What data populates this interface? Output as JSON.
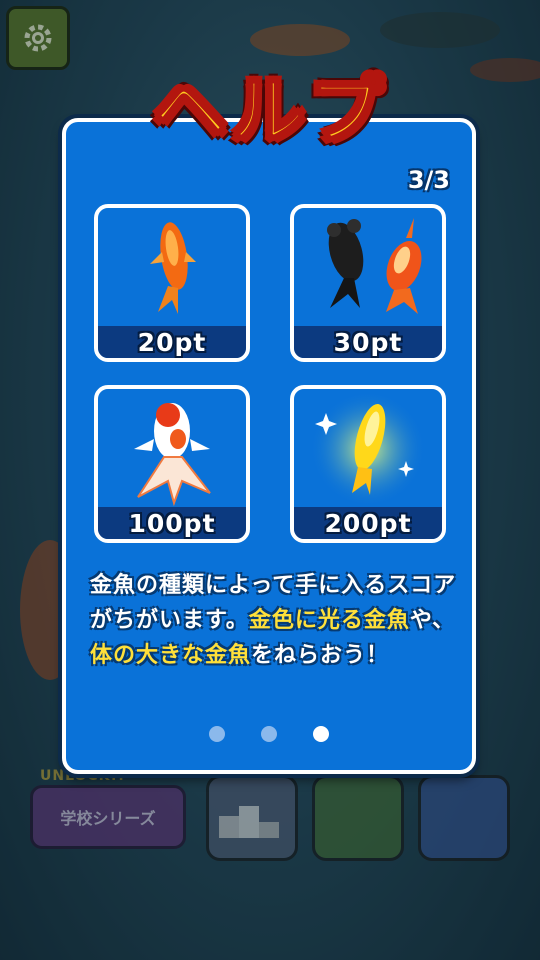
{
  "title": "ヘルプ",
  "page_indicator": "3/3",
  "cards": [
    {
      "points": "20pt",
      "fish": "red-goldfish"
    },
    {
      "points": "30pt",
      "fish": "black-and-red-goldfish"
    },
    {
      "points": "100pt",
      "fish": "fancy-red-white-goldfish"
    },
    {
      "points": "200pt",
      "fish": "golden-goldfish"
    }
  ],
  "description": {
    "part1": "金魚の種類によって手に入るスコアがちがいます。",
    "highlight1": "金色に光る金魚",
    "part2": "や、",
    "highlight2": "体の大きな金魚",
    "part3": "をねらおう！"
  },
  "pagination": {
    "total": 3,
    "current": 3
  },
  "background": {
    "school_series_label": "学校シリーズ",
    "unlock_label": "UNLOCK!!"
  },
  "colors": {
    "panel_blue": "#0a72d8",
    "title_yellow": "#ffcb1f",
    "title_outline": "#b3160f",
    "highlight_yellow": "#ffe03a"
  }
}
